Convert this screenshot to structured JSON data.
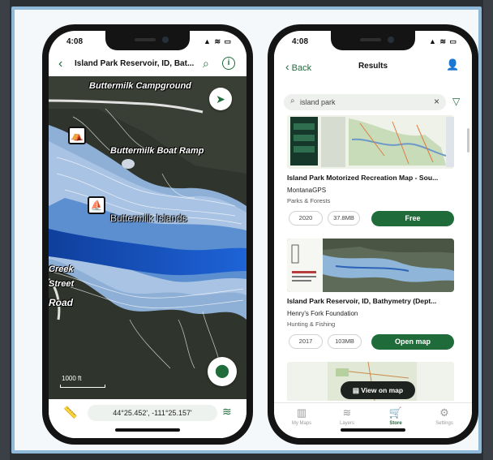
{
  "left_phone": {
    "status": {
      "time": "4:08",
      "icons": "▲ ≋ ▭"
    },
    "header": {
      "back_icon": "chevron-left-icon",
      "title": "Island Park Reservoir, ID, Bat...",
      "search_icon": "search-icon",
      "info_icon": "info-icon"
    },
    "map": {
      "labels": {
        "campground": "Buttermilk Campground",
        "boat_ramp": "Buttermilk Boat Ramp",
        "islands": "Buttermilk Islands",
        "road_a": "Creek",
        "road_b": "Street",
        "road_c": "Road"
      },
      "scale_label": "1000 ft",
      "poi_icons": [
        "tent-icon",
        "boat-icon"
      ],
      "nav_icon": "navigation-arrow-icon",
      "pin_icon": "location-pin-icon"
    },
    "bottom": {
      "ruler_icon": "ruler-icon",
      "coordinates": "44°25.452', -111°25.157'",
      "layers_icon": "layers-icon"
    }
  },
  "right_phone": {
    "status": {
      "time": "4:08",
      "icons": "▲ ≋ ▭"
    },
    "header": {
      "back_label": "Back",
      "title": "Results",
      "account_icon": "account-check-icon"
    },
    "search": {
      "value": "island park",
      "clear_icon": "close-icon",
      "filter_icon": "filter-icon"
    },
    "results": [
      {
        "title": "Island Park Motorized Recreation Map - Sou...",
        "publisher": "MontanaGPS",
        "category": "Parks & Forests",
        "year": "2020",
        "size": "37.8MB",
        "action": "Free"
      },
      {
        "title": "Island Park Reservoir, ID, Bathymetry (Dept...",
        "publisher": "Henry's Fork Foundation",
        "category": "Hunting & Fishing",
        "year": "2017",
        "size": "103MB",
        "action": "Open map"
      }
    ],
    "view_map_label": "View on map",
    "tabs": [
      {
        "label": "My Maps",
        "icon": "maps-icon"
      },
      {
        "label": "Layers",
        "icon": "layers-icon"
      },
      {
        "label": "Store",
        "icon": "cart-icon"
      },
      {
        "label": "Settings",
        "icon": "gear-icon"
      }
    ],
    "active_tab": "Store"
  },
  "colors": {
    "accent": "#1f6b3a",
    "frame": "#8fb9d8",
    "water": "#3b6fc0"
  }
}
